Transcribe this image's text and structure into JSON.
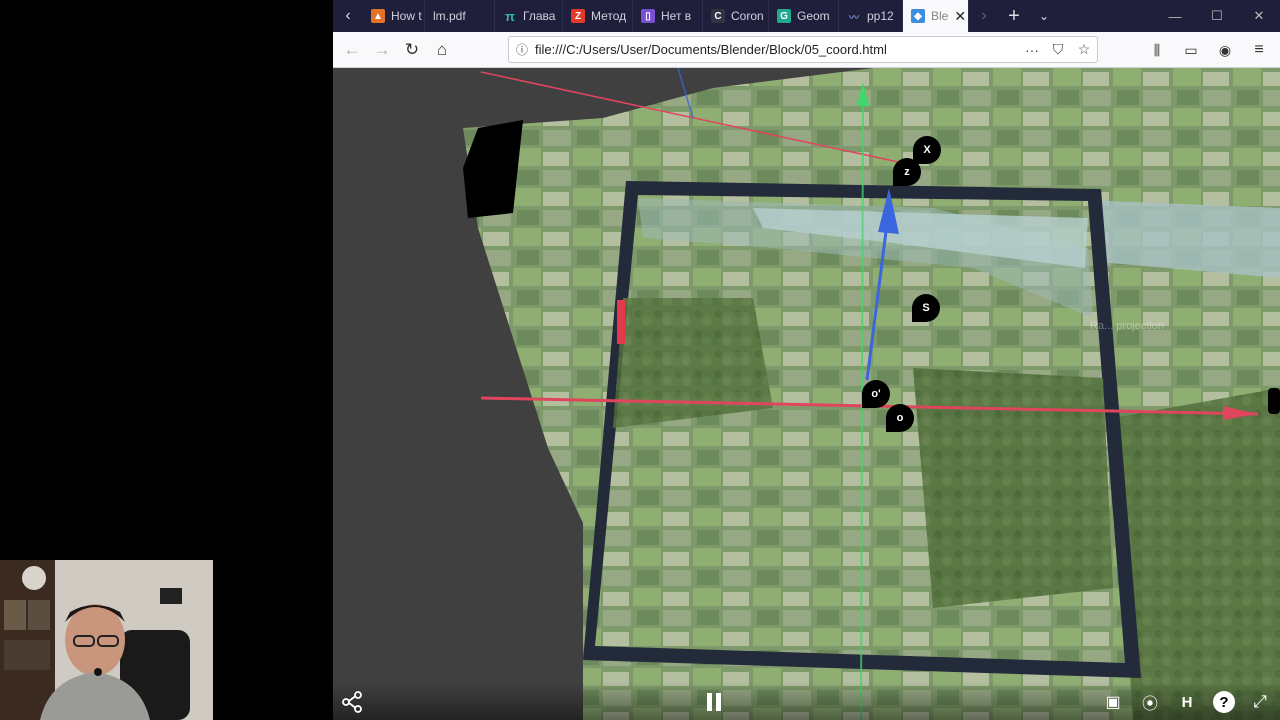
{
  "browser": {
    "tabs": [
      {
        "label": "How t",
        "icon": "fire-icon",
        "color": "#e5722a"
      },
      {
        "label": "lm.pdf",
        "icon": "pdf-icon",
        "color": "#2a2a4a"
      },
      {
        "label": "Глава",
        "icon": "pi-icon",
        "color": "#2bb9a8"
      },
      {
        "label": "Метод",
        "icon": "z-icon",
        "color": "#e23a2a"
      },
      {
        "label": "Нет в",
        "icon": "doc-icon",
        "color": "#7b4fd3"
      },
      {
        "label": "Coron",
        "icon": "c-icon",
        "color": "#333344"
      },
      {
        "label": "Geom",
        "icon": "g-icon",
        "color": "#21a98d"
      },
      {
        "label": "pp12",
        "icon": "wave-icon",
        "color": "#6a8ccc"
      },
      {
        "label": "Ble",
        "icon": "shield-icon",
        "color": "#3c8de0",
        "active": true
      }
    ],
    "url": "file:///C:/Users/User/Documents/Blender/Block/05_coord.html"
  },
  "scene": {
    "labels": {
      "x": "X",
      "z": "z",
      "s": "S",
      "o_prime": "o'",
      "o": "o"
    },
    "watermark": "Ra... projection"
  },
  "colors": {
    "x_axis": "#e0455e",
    "y_axis": "#3fd86a",
    "z_axis": "#3a66e0",
    "frame": "#232a3a",
    "tab_bar": "#1f1f3b"
  }
}
